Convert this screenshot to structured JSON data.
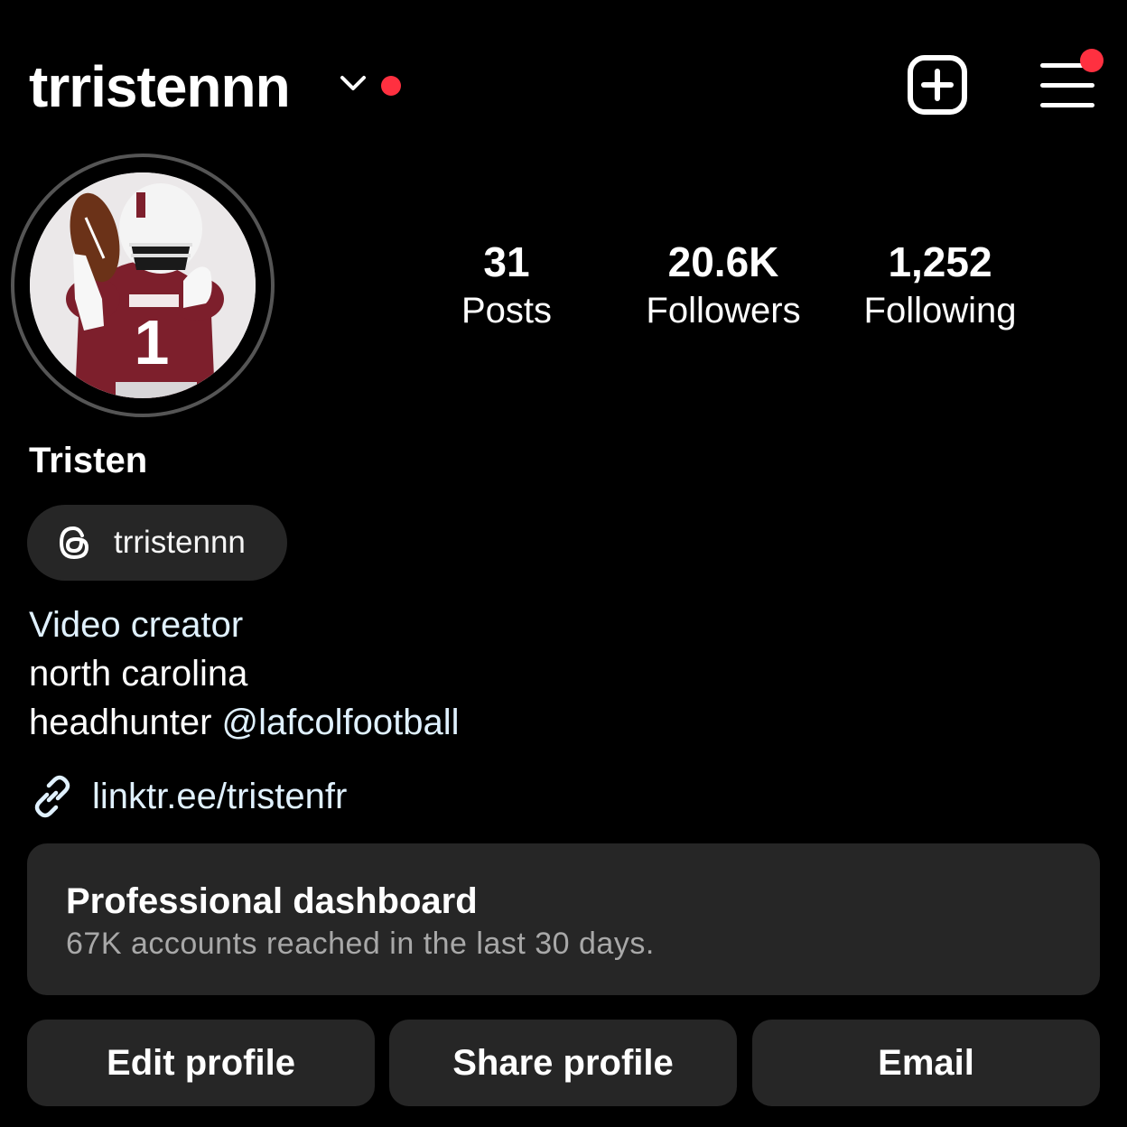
{
  "header": {
    "username": "trristennn",
    "account_switch_icon": "chevron-down-icon",
    "create_icon": "plus-square-icon",
    "menu_icon": "hamburger-menu-icon"
  },
  "profile": {
    "avatar_icon": "profile-photo",
    "stats": [
      {
        "value": "31",
        "label": "Posts"
      },
      {
        "value": "20.6K",
        "label": "Followers"
      },
      {
        "value": "1,252",
        "label": "Following"
      }
    ],
    "display_name": "Tristen",
    "threads_handle": "trristennn",
    "category": "Video creator",
    "bio_line_1": "north carolina",
    "bio_line_2_prefix": "headhunter ",
    "bio_line_2_mention": "@lafcolfootball",
    "link": "linktr.ee/tristenfr"
  },
  "dashboard": {
    "title": "Professional dashboard",
    "subtitle": "67K accounts reached in the last 30 days."
  },
  "actions": {
    "edit_profile": "Edit profile",
    "share_profile": "Share profile",
    "email": "Email"
  },
  "colors": {
    "background": "#000000",
    "surface": "#262626",
    "notification": "#ff3040",
    "link": "#e0f1ff",
    "secondary_text": "#a8a8a8"
  }
}
